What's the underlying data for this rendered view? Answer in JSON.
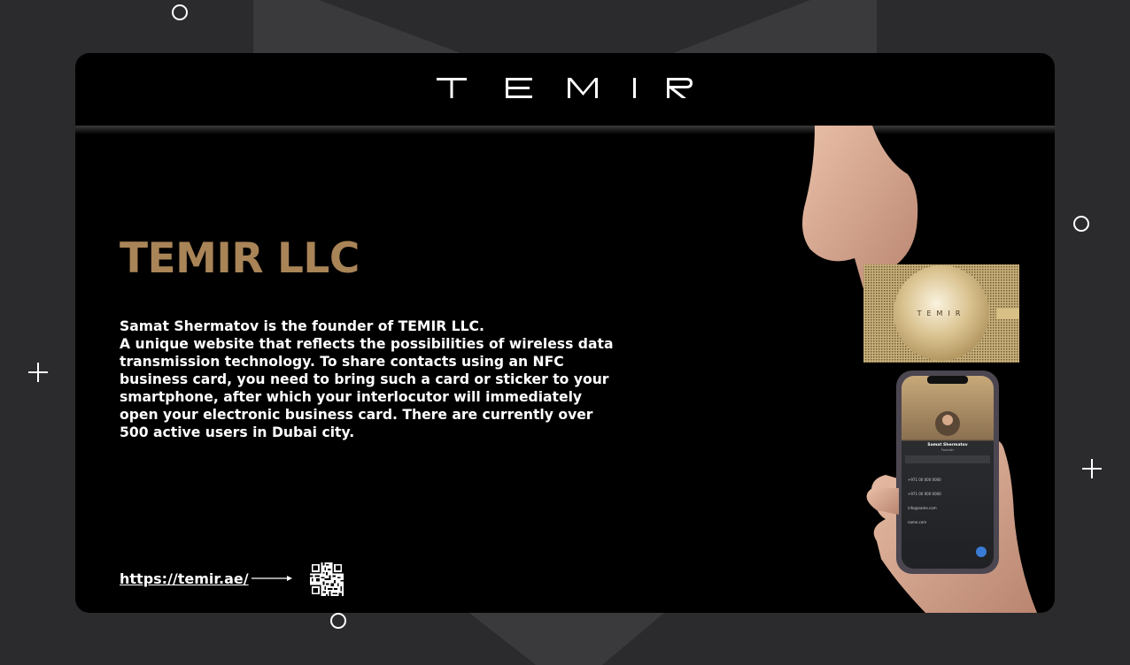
{
  "brand": {
    "logo_text": "TEMIR",
    "card_logo_text": "TEMIR"
  },
  "company": {
    "title": "TEMIR LLC"
  },
  "description": {
    "intro": "Samat Shermatov is the founder of TEMIR LLC.",
    "body": "A unique website that reflects the possibilities of wireless data transmission technology. To share contacts using an NFC business card, you need to bring such a card or sticker to your smartphone, after which your interlocutor will immediately open your electronic business card. There are currently over 500 active users in Dubai city."
  },
  "website": {
    "url_text": "https://temir.ae/"
  },
  "phone_screen": {
    "name": "Samat Shermatov",
    "role": "Founder",
    "fields": [
      "+971 00 000 0000",
      "+971 00 000 0000",
      "info@name.com",
      "name.com"
    ]
  },
  "colors": {
    "background": "#2b2b2d",
    "card": "#000000",
    "accent_gold": "#a98457",
    "text": "#ffffff"
  },
  "icons": [
    "ring-decoration",
    "plus-decoration",
    "arrow-right-icon",
    "qr-code-icon"
  ]
}
